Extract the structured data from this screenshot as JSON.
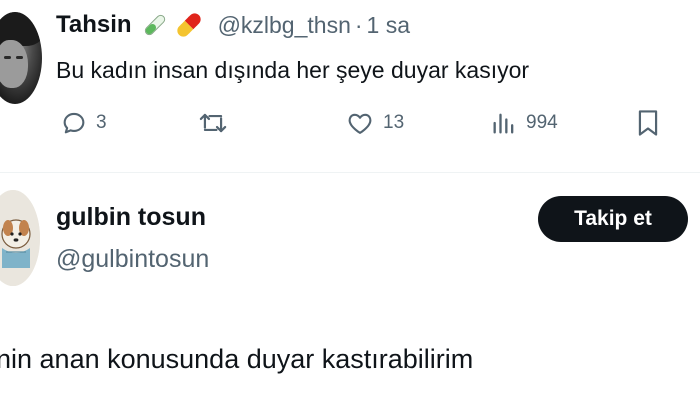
{
  "tweet": {
    "author_name": "Tahsin",
    "name_emojis": [
      "test-tube-icon",
      "pill-icon"
    ],
    "handle": "@kzlbg_thsn",
    "separator": "·",
    "time": "1 sa",
    "text": "Bu kadın insan dışında her şeye duyar kasıyor",
    "actions": {
      "replies": "3",
      "retweets": "",
      "likes": "13",
      "views": "994"
    }
  },
  "reply": {
    "author_name": "gulbin tosun",
    "handle": "@gulbintosun",
    "follow_label": "Takip et",
    "text": "nin anan konusunda duyar kastırabilirim"
  },
  "colors": {
    "text": "#0f1419",
    "secondary": "#536471",
    "button_bg": "#0f1419",
    "button_text": "#ffffff",
    "divider": "#eff3f4"
  }
}
